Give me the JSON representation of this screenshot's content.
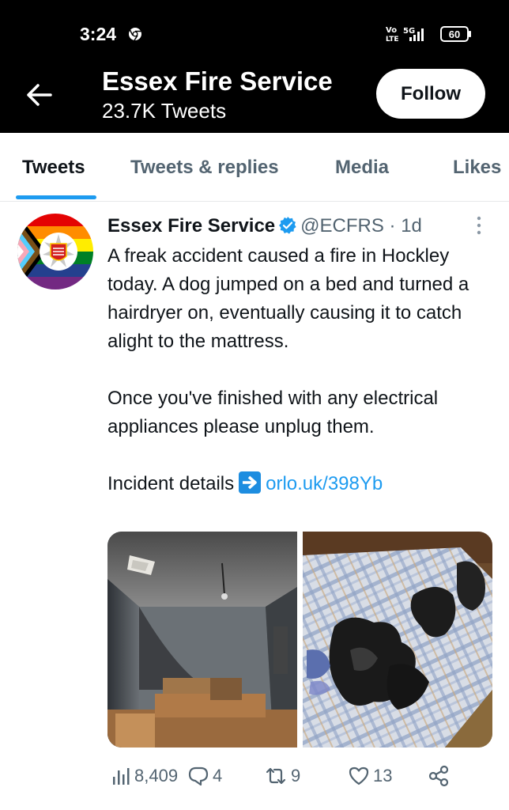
{
  "status_bar": {
    "time": "3:24",
    "network": "5G",
    "battery": "60"
  },
  "header": {
    "title": "Essex Fire Service",
    "subtitle": "23.7K Tweets",
    "follow_label": "Follow"
  },
  "tabs": [
    {
      "label": "Tweets",
      "active": true
    },
    {
      "label": "Tweets & replies",
      "active": false
    },
    {
      "label": "Media",
      "active": false
    },
    {
      "label": "Likes",
      "active": false
    }
  ],
  "tweet": {
    "display_name": "Essex Fire Service",
    "handle": "@ECFRS",
    "separator": "·",
    "time": "1d",
    "paragraph1": "A freak accident caused a fire in Hockley today. A dog jumped on a bed and turned a hairdryer on, eventually causing it to catch alight to the mattress.",
    "paragraph2": "Once you've finished with any electrical appliances please unplug them.",
    "details_label": "Incident details",
    "link": "orlo.uk/398Yb",
    "stats": {
      "views": "8,409",
      "replies": "4",
      "retweets": "9",
      "likes": "13"
    }
  },
  "colors": {
    "accent": "#1d9bf0",
    "text": "#0f1419",
    "secondary": "#536471"
  }
}
